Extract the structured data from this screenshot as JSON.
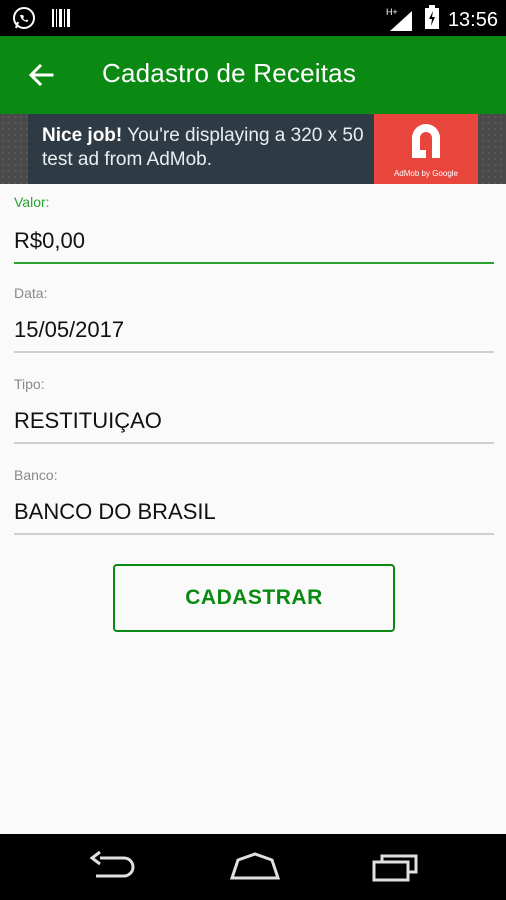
{
  "status_bar": {
    "time": "13:56",
    "network_label": "H+"
  },
  "app_bar": {
    "title": "Cadastro de Receitas"
  },
  "ad": {
    "bold": "Nice job!",
    "text": "You're displaying a 320 x 50 test ad from AdMob.",
    "brand": "AdMob by Google"
  },
  "form": {
    "valor": {
      "label": "Valor:",
      "value": "R$0,00"
    },
    "data": {
      "label": "Data:",
      "value": "15/05/2017"
    },
    "tipo": {
      "label": "Tipo:",
      "value": "RESTITUIÇAO"
    },
    "banco": {
      "label": "Banco:",
      "value": "BANCO DO BRASIL"
    }
  },
  "button": {
    "label": "CADASTRAR"
  },
  "colors": {
    "accent": "#0a8a12",
    "active_field": "#2aa32f"
  }
}
